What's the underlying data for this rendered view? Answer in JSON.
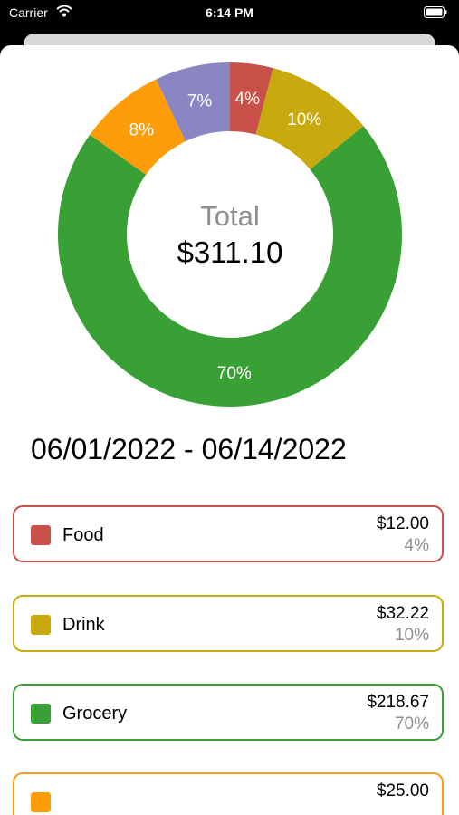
{
  "status_bar": {
    "carrier": "Carrier",
    "time": "6:14 PM"
  },
  "summary": {
    "total_label": "Total",
    "total_value": "$311.10"
  },
  "date_range": "06/01/2022 - 06/14/2022",
  "chart_data": {
    "type": "pie",
    "title": "",
    "slices": [
      {
        "label": "4%",
        "value": 4,
        "color": "#c9514a"
      },
      {
        "label": "10%",
        "value": 10,
        "color": "#c8aa0f"
      },
      {
        "label": "70%",
        "value": 70,
        "color": "#38a035"
      },
      {
        "label": "8%",
        "value": 8,
        "color": "#ff9c0a"
      },
      {
        "label": "7%",
        "value": 7,
        "color": "#8a86c4"
      }
    ]
  },
  "categories": [
    {
      "name": "Food",
      "amount": "$12.00",
      "percent": "4%",
      "color": "#c9514a"
    },
    {
      "name": "Drink",
      "amount": "$32.22",
      "percent": "10%",
      "color": "#c8aa0f"
    },
    {
      "name": "Grocery",
      "amount": "$218.67",
      "percent": "70%",
      "color": "#38a035"
    },
    {
      "name": "",
      "amount": "$25.00",
      "percent": "",
      "color": "#ff9c0a"
    }
  ]
}
